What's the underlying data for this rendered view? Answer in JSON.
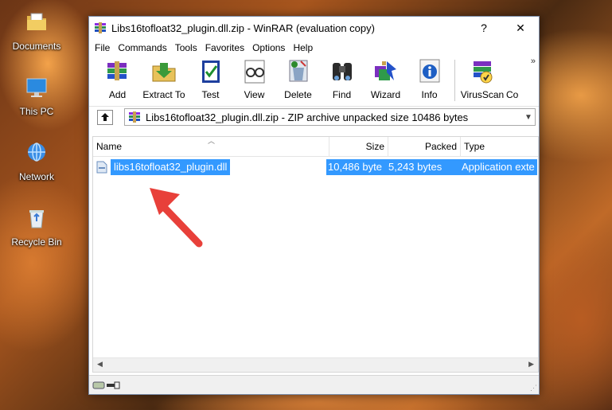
{
  "desktop": {
    "icons": [
      {
        "label": "Documents",
        "icon": "folder-documents-icon"
      },
      {
        "label": "This PC",
        "icon": "computer-icon"
      },
      {
        "label": "Network",
        "icon": "network-icon"
      },
      {
        "label": "Recycle Bin",
        "icon": "recycle-bin-icon"
      }
    ]
  },
  "window": {
    "title": "Libs16tofloat32_plugin.dll.zip - WinRAR (evaluation copy)",
    "help_glyph": "?",
    "close_glyph": "✕"
  },
  "menu": [
    "File",
    "Commands",
    "Tools",
    "Favorites",
    "Options",
    "Help"
  ],
  "toolbar": {
    "buttons": [
      {
        "label": "Add",
        "icon": "add-archive-icon"
      },
      {
        "label": "Extract To",
        "icon": "extract-folder-icon"
      },
      {
        "label": "Test",
        "icon": "test-check-icon"
      },
      {
        "label": "View",
        "icon": "view-glasses-icon"
      },
      {
        "label": "Delete",
        "icon": "delete-recycle-icon"
      },
      {
        "label": "Find",
        "icon": "find-binoculars-icon"
      },
      {
        "label": "Wizard",
        "icon": "wizard-icon"
      },
      {
        "label": "Info",
        "icon": "info-icon"
      },
      {
        "label": "VirusScan",
        "icon": "virus-scan-icon"
      },
      {
        "label": "Co",
        "icon": "comment-icon"
      }
    ],
    "overflow_glyph": "»"
  },
  "address": {
    "text": "Libs16tofloat32_plugin.dll.zip - ZIP archive unpacked size 10486 bytes"
  },
  "list": {
    "columns": {
      "name": "Name",
      "size": "Size",
      "packed": "Packed",
      "type": "Type"
    },
    "rows": [
      {
        "name": "libs16tofloat32_plugin.dll",
        "size": "10,486 byte",
        "packed": "5,243 bytes",
        "type": "Application exte"
      }
    ]
  },
  "colors": {
    "selection": "#3399ff",
    "arrow": "#e8403a"
  }
}
